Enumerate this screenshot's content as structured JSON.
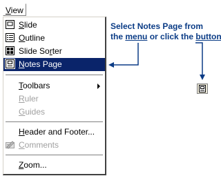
{
  "menubar": {
    "view_label": "View",
    "view_mnemonic": "V",
    "view_rest": "iew"
  },
  "menu": {
    "items": [
      {
        "label": "Slide",
        "mnemonic": "S",
        "rest": "lide",
        "icon": "slide-view-icon",
        "enabled": true
      },
      {
        "label": "Outline",
        "mnemonic": "O",
        "rest": "utline",
        "icon": "outline-view-icon",
        "enabled": true
      },
      {
        "label": "Slide Sorter",
        "pre": "Slide ",
        "mnemonic": "r",
        "rest": "ter",
        "pre2": "So",
        "icon": "slide-sorter-icon",
        "enabled": true
      },
      {
        "label": "Notes Page",
        "mnemonic": "N",
        "rest": "otes Page",
        "icon": "notes-page-icon",
        "enabled": true,
        "selected": true
      },
      {
        "label": "Toolbars",
        "mnemonic": "T",
        "rest": "oolbars",
        "enabled": true,
        "submenu": true
      },
      {
        "label": "Ruler",
        "mnemonic": "R",
        "rest": "uler",
        "enabled": false
      },
      {
        "label": "Guides",
        "mnemonic": "G",
        "rest": "uides",
        "enabled": false
      },
      {
        "label": "Header and Footer...",
        "mnemonic": "H",
        "rest": "eader and Footer...",
        "enabled": true
      },
      {
        "label": "Comments",
        "mnemonic": "C",
        "rest": "omments",
        "icon": "comments-icon",
        "enabled": false
      },
      {
        "label": "Zoom...",
        "mnemonic": "Z",
        "rest": "oom...",
        "enabled": true
      }
    ]
  },
  "callout": {
    "line1": "Select Notes Page from",
    "line2_pre": "the ",
    "line2_menu": "menu",
    "line2_mid": " or click the ",
    "line2_button": "button"
  },
  "colors": {
    "selection": "#0a246a",
    "callout_text": "#0b3c86",
    "arrow": "#0b3c86"
  },
  "toolbar_button": {
    "icon": "notes-page-icon"
  }
}
